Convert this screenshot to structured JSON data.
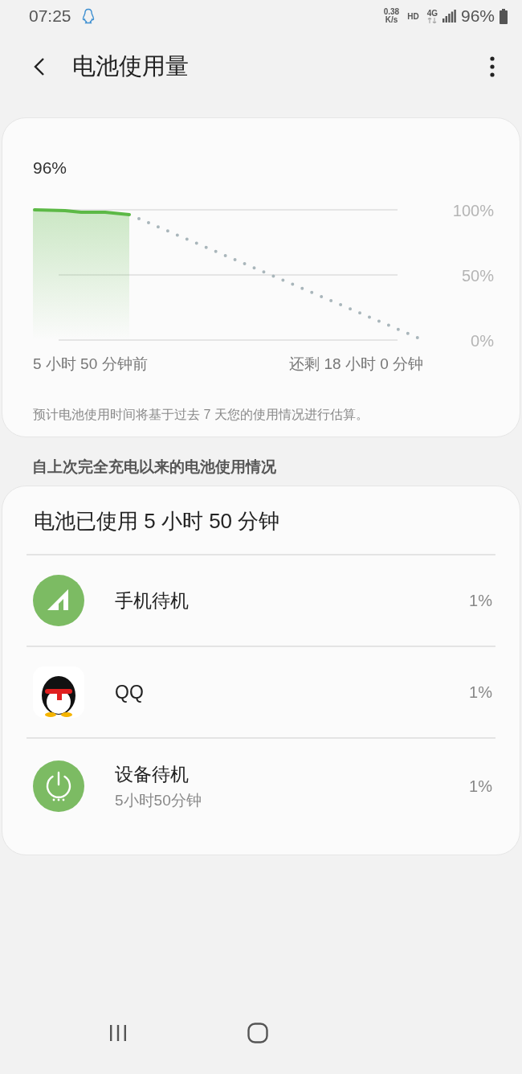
{
  "status_bar": {
    "time": "07:25",
    "speed_value": "0.38",
    "speed_unit": "K/s",
    "hd": "HD",
    "network": "4G",
    "battery": "96%"
  },
  "header": {
    "title": "电池使用量"
  },
  "battery_card": {
    "level_text": "96%",
    "scale_labels": [
      "100%",
      "50%",
      "0%"
    ],
    "start_label": "5 小时 50 分钟前",
    "end_label": "还剩 18 小时 0 分钟",
    "note": "预计电池使用时间将基于过去 7 天您的使用情况进行估算。"
  },
  "section_title": "自上次完全充电以来的电池使用情况",
  "usage_card": {
    "title": "电池已使用 5 小时 50 分钟",
    "items": [
      {
        "kind": "signal",
        "name": "手机待机",
        "percent": "1%"
      },
      {
        "kind": "app",
        "name": "QQ",
        "percent": "1%"
      },
      {
        "kind": "power",
        "name": "设备待机",
        "detail": "5小时50分钟",
        "percent": "1%"
      }
    ]
  }
}
